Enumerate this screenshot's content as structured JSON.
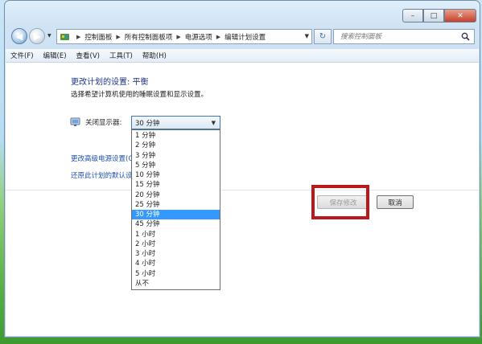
{
  "window": {
    "caption_buttons": {
      "minimize": "–",
      "maximize": "□",
      "close": "✕"
    },
    "nav": {
      "back_icon": "back-arrow-icon",
      "forward_icon": "forward-arrow-icon"
    },
    "breadcrumb": [
      "控制面板",
      "所有控制面板项",
      "电源选项",
      "编辑计划设置"
    ],
    "search_placeholder": "搜索控制面板"
  },
  "menubar": {
    "file": "文件(F)",
    "edit": "编辑(E)",
    "view": "查看(V)",
    "tools": "工具(T)",
    "help": "帮助(H)"
  },
  "main": {
    "heading": "更改计划的设置: 平衡",
    "subtext": "选择希望计算机使用的睡眠设置和显示设置。",
    "display_label": "关闭显示器:",
    "display_value": "30 分钟",
    "link_advanced": "更改高级电源设置(C)",
    "link_restore": "还原此计划的默认设置",
    "save_button": "保存修改",
    "cancel_button": "取消"
  },
  "dropdown_options": [
    "1 分钟",
    "2 分钟",
    "3 分钟",
    "5 分钟",
    "10 分钟",
    "15 分钟",
    "20 分钟",
    "25 分钟",
    "30 分钟",
    "45 分钟",
    "1 小时",
    "2 小时",
    "3 小时",
    "4 小时",
    "5 小时",
    "从不"
  ],
  "dropdown_selected_index": 8,
  "colors": {
    "link": "#1e4fb0",
    "heading": "#1e3287",
    "selection": "#3399ff",
    "highlight_box": "#b9191a"
  }
}
